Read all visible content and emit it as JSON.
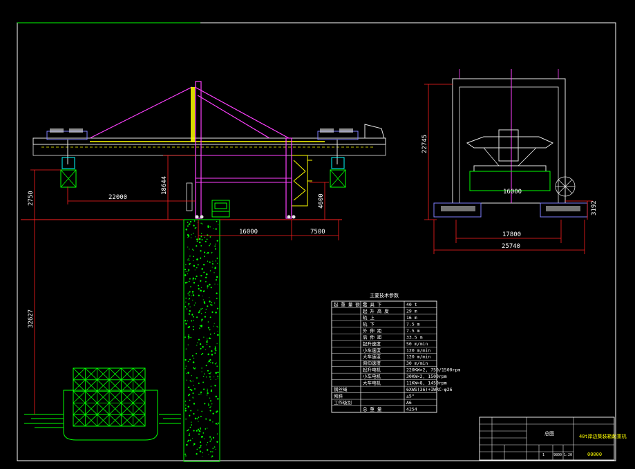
{
  "colors": {
    "background": "#000000",
    "frame": "#ffffff",
    "dimension": "#ff2020",
    "structure_purple": "#ff40ff",
    "structure_yellow": "#ffff00",
    "structure_white": "#e8e8e8",
    "hatch_green": "#00ff00",
    "cyan": "#00ffff",
    "magenta": "#ff00ff"
  },
  "side_view": {
    "dims": {
      "left_height": "2750",
      "outreach": "22000",
      "lift_height": "18644",
      "backreach_height": "4600",
      "gauge": "16000",
      "backreach": "7500",
      "below_rail": "32627"
    }
  },
  "end_view": {
    "dims": {
      "height": "22745",
      "inner_height": "16000",
      "base_height": "3192",
      "inner_width": "17800",
      "overall_width": "25740"
    }
  },
  "spec_table": {
    "title": "主要技术参数",
    "rows": [
      {
        "c1": "起 重 量 额 定",
        "c2": "吊 具 下",
        "c3": "40 t"
      },
      {
        "c1": "",
        "c2": "起 升 高 度",
        "c3": "29 m"
      },
      {
        "c1": "",
        "c2": "轨 上",
        "c3": "16 m"
      },
      {
        "c1": "",
        "c2": "轨 下",
        "c3": "7.5 m"
      },
      {
        "c1": "",
        "c2": "外 伸 距",
        "c3": "7.5 m"
      },
      {
        "c1": "",
        "c2": "后 伸 距",
        "c3": "33.5 m"
      },
      {
        "c1": "",
        "c2": "起升速度",
        "c3": "50 m/min"
      },
      {
        "c1": "",
        "c2": "小车速度",
        "c3": "120 m/min"
      },
      {
        "c1": "",
        "c2": "大车速度",
        "c3": "120 m/min"
      },
      {
        "c1": "",
        "c2": "俯仰速度",
        "c3": "30 m/min"
      },
      {
        "c1": "",
        "c2": "起升电机",
        "c3": "220KW×2, 750/1500rpm"
      },
      {
        "c1": "",
        "c2": "小车电机",
        "c3": "30KW×2, 1500rpm"
      },
      {
        "c1": "",
        "c2": "大车电机",
        "c3": "11KW×8, 1450rpm"
      },
      {
        "c1": "钢丝绳",
        "c2": "",
        "c3": "6XWS(36)+IWRC-φ26"
      },
      {
        "c1": "倾斜",
        "c2": "",
        "c3": "±5°"
      },
      {
        "c1": "工作级别",
        "c2": "",
        "c3": "A6"
      },
      {
        "c1": "",
        "c2": "总 重 量",
        "c3": "4254"
      }
    ]
  },
  "title_block": {
    "drawing_name": "40t岸边集装箱起重机",
    "drawing_no": "00000",
    "mid_label": "总图",
    "scale": "1:20",
    "count": "1",
    "code": "9800"
  }
}
